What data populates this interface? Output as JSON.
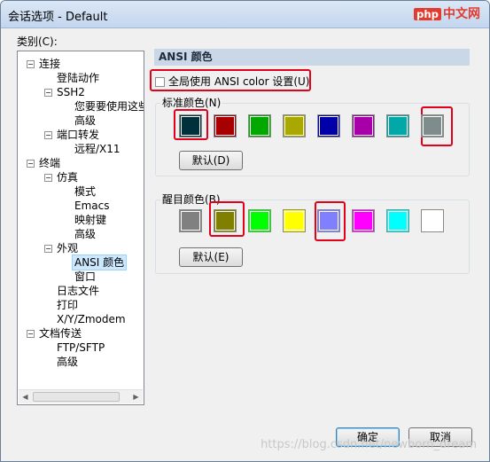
{
  "window": {
    "title": "会话选项 - Default",
    "brand_php": "php",
    "brand_site": "中文网"
  },
  "category_label": "类别(C):",
  "tree": {
    "items": [
      {
        "label": "连接",
        "exp": "−"
      },
      {
        "label": "登陆动作"
      },
      {
        "label": "SSH2",
        "exp": "−"
      },
      {
        "label": "您要要使用这些设"
      },
      {
        "label": "高级"
      },
      {
        "label": "端口转发",
        "exp": "−"
      },
      {
        "label": "远程/X11"
      },
      {
        "label": "终端",
        "exp": "−"
      },
      {
        "label": "仿真",
        "exp": "−"
      },
      {
        "label": "模式"
      },
      {
        "label": "Emacs"
      },
      {
        "label": "映射键"
      },
      {
        "label": "高级"
      },
      {
        "label": "外观",
        "exp": "−"
      },
      {
        "label": "ANSI 颜色"
      },
      {
        "label": "窗口"
      },
      {
        "label": "日志文件"
      },
      {
        "label": "打印"
      },
      {
        "label": "X/Y/Zmodem"
      },
      {
        "label": "文档传送",
        "exp": "−"
      },
      {
        "label": "FTP/SFTP"
      },
      {
        "label": "高级"
      }
    ],
    "scroll_left": "◀",
    "scroll_right": "▶"
  },
  "section_title": "ANSI 颜色",
  "global_checkbox": {
    "label": "全局使用 ANSI color 设置(U)",
    "checked": false
  },
  "standard": {
    "title": "标准颜色(N)",
    "colors": [
      "#00303a",
      "#a80000",
      "#00a800",
      "#a8a800",
      "#0000a8",
      "#a800a8",
      "#00a8a8",
      "#7f8c8c"
    ],
    "default_button": "默认(D)"
  },
  "bright": {
    "title": "醒目颜色(B)",
    "colors": [
      "#808080",
      "#808000",
      "#00ff00",
      "#ffff00",
      "#8080ff",
      "#ff00ff",
      "#00ffff",
      "#ffffff"
    ],
    "default_button": "默认(E)"
  },
  "buttons": {
    "ok": "确定",
    "cancel": "取消"
  },
  "watermark": "https://blog.csdn.net/newborn_dream"
}
